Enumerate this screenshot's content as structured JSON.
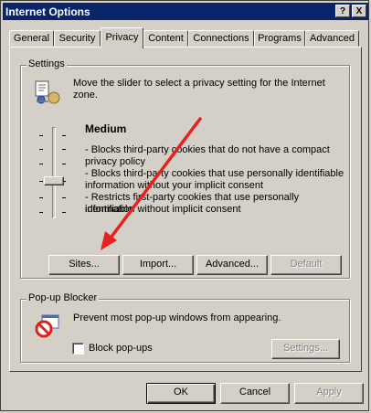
{
  "window": {
    "title": "Internet Options",
    "help_button": "?",
    "close_button": "X"
  },
  "tabs": [
    {
      "label": "General"
    },
    {
      "label": "Security"
    },
    {
      "label": "Privacy",
      "active": true
    },
    {
      "label": "Content"
    },
    {
      "label": "Connections"
    },
    {
      "label": "Programs"
    },
    {
      "label": "Advanced"
    }
  ],
  "settings": {
    "group_label": "Settings",
    "intro_line1": "Move the slider to select a privacy setting for the Internet",
    "intro_line2": "zone.",
    "level": "Medium",
    "slider_position": "middle",
    "desc": [
      "- Blocks third-party cookies that do not have a compact",
      "privacy policy",
      "- Blocks third-party cookies that use personally identifiable",
      "information without your implicit consent",
      "- Restricts first-party cookies that use personally identifiable",
      "information without implicit consent"
    ],
    "buttons": {
      "sites": "Sites...",
      "import": "Import...",
      "advanced": "Advanced...",
      "default": "Default"
    }
  },
  "popup": {
    "group_label": "Pop-up Blocker",
    "description": "Prevent most pop-up windows from appearing.",
    "checkbox_label": "Block pop-ups",
    "checkbox_checked": false,
    "settings_button": "Settings..."
  },
  "footer": {
    "ok": "OK",
    "cancel": "Cancel",
    "apply": "Apply"
  },
  "annotation": {
    "arrow_color": "#e8201e",
    "points_to": "Sites..."
  },
  "colors": {
    "titlebar": "#0a246a",
    "face": "#d4d0c8"
  }
}
